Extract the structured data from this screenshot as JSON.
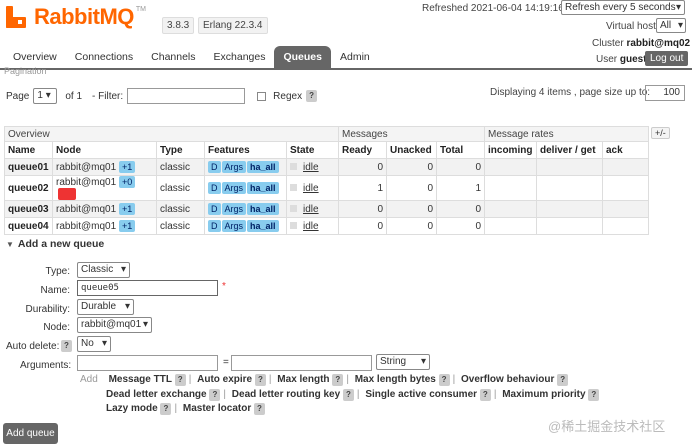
{
  "header": {
    "app_name": "RabbitMQ",
    "tm": "TM",
    "version": "3.8.3",
    "erlang": "Erlang 22.3.4",
    "refreshed": "Refreshed 2021-06-04 14:19:16",
    "refresh_option": "Refresh every 5 seconds",
    "vhost_label": "Virtual host",
    "vhost_value": "All",
    "cluster_label": "Cluster",
    "cluster_value": "rabbit@mq02",
    "user_label": "User",
    "user_value": "guest",
    "logout": "Log out",
    "brand_color": "#ff6600"
  },
  "tabs": [
    "Overview",
    "Connections",
    "Channels",
    "Exchanges",
    "Queues",
    "Admin"
  ],
  "active_tab": "Queues",
  "pagination_cut": "Pagination",
  "pager": {
    "page_label": "Page",
    "page_value": "1",
    "of_label": "of 1",
    "filter_label": "- Filter:",
    "filter_value": "",
    "regex_label": "Regex",
    "help": "?",
    "displaying": "Displaying 4 items , page size up to:",
    "page_size": "100"
  },
  "table": {
    "group_overview": "Overview",
    "group_messages": "Messages",
    "group_rates": "Message rates",
    "toggle": "+/-",
    "columns": [
      "Name",
      "Node",
      "Type",
      "Features",
      "State",
      "Ready",
      "Unacked",
      "Total",
      "incoming",
      "deliver / get",
      "ack"
    ],
    "rows": [
      {
        "name": "queue01",
        "node": "rabbit@mq01",
        "mirror": "+1",
        "type": "classic",
        "f1": "D",
        "f2": "Args",
        "f3": "ha_all",
        "state": "idle",
        "ready": "0",
        "unacked": "0",
        "total": "0"
      },
      {
        "name": "queue02",
        "node": "rabbit@mq01",
        "mirror": "+0",
        "type": "classic",
        "f1": "D",
        "f2": "Args",
        "f3": "ha_all",
        "state": "idle",
        "ready": "1",
        "unacked": "0",
        "total": "1"
      },
      {
        "name": "queue03",
        "node": "rabbit@mq01",
        "mirror": "+1",
        "type": "classic",
        "f1": "D",
        "f2": "Args",
        "f3": "ha_all",
        "state": "idle",
        "ready": "0",
        "unacked": "0",
        "total": "0"
      },
      {
        "name": "queue04",
        "node": "rabbit@mq01",
        "mirror": "+1",
        "type": "classic",
        "f1": "D",
        "f2": "Args",
        "f3": "ha_all",
        "state": "idle",
        "ready": "0",
        "unacked": "0",
        "total": "0"
      }
    ]
  },
  "add_queue": {
    "title": "Add a new queue",
    "type_label": "Type:",
    "type_value": "Classic",
    "name_label": "Name:",
    "name_value": "queue05",
    "required": "*",
    "durability_label": "Durability:",
    "durability_value": "Durable",
    "node_label": "Node:",
    "node_value": "rabbit@mq01",
    "autodelete_label": "Auto delete:",
    "autodelete_value": "No",
    "arguments_label": "Arguments:",
    "equals": "=",
    "arg_type": "String",
    "add_label": "Add",
    "args_line1": [
      "Message TTL",
      "Auto expire",
      "Max length",
      "Max length bytes",
      "Overflow behaviour"
    ],
    "args_line2": [
      "Dead letter exchange",
      "Dead letter routing key",
      "Single active consumer",
      "Maximum priority"
    ],
    "args_line3": [
      "Lazy mode",
      "Master locator"
    ],
    "button": "Add queue"
  },
  "watermark": "@稀土掘金技术社区"
}
